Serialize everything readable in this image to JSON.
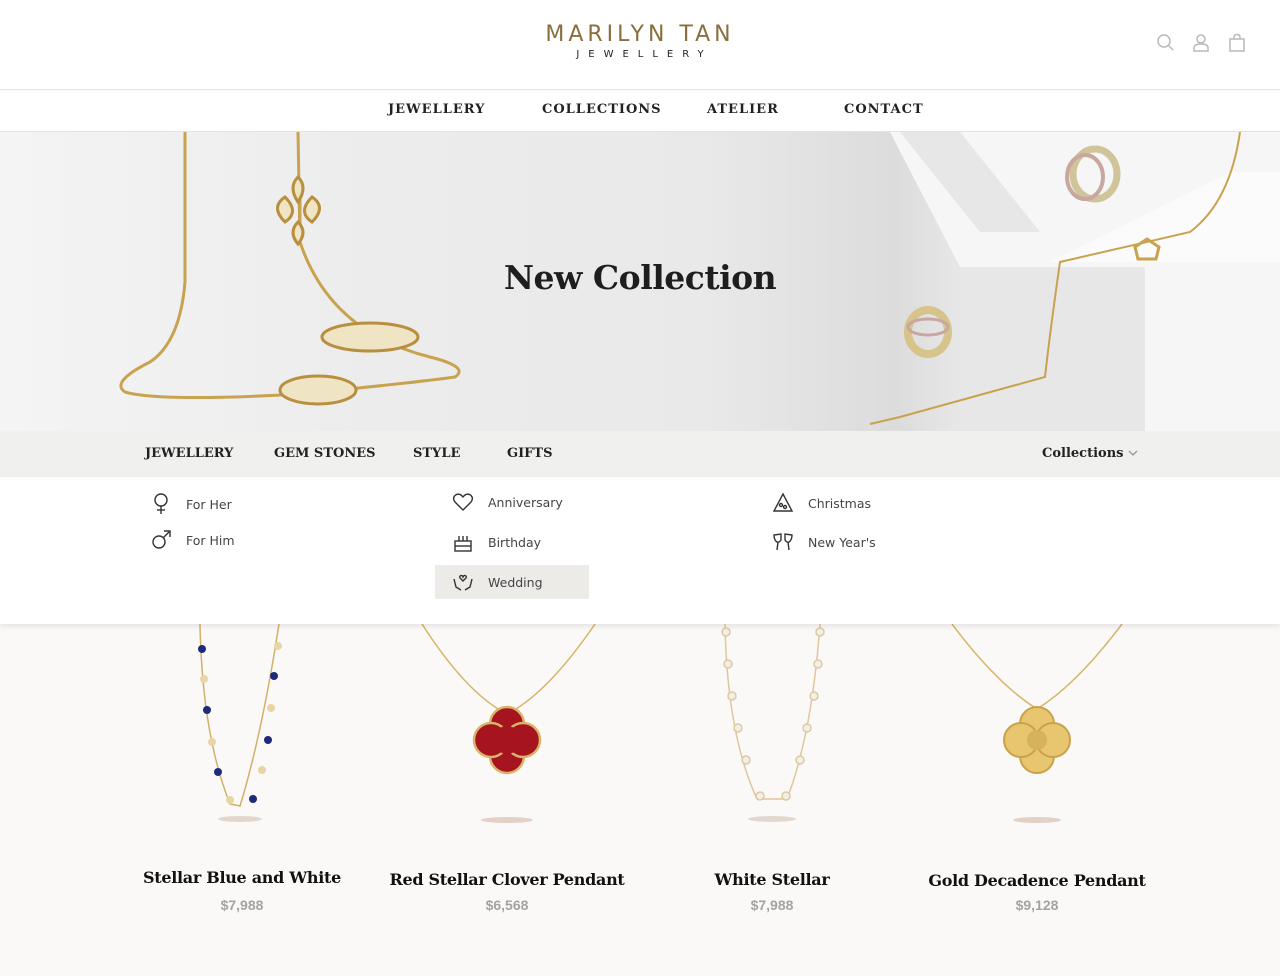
{
  "brand": {
    "name": "MARILYN TAN",
    "subtitle": "JEWELLERY"
  },
  "header": {
    "icons": [
      "search-icon",
      "user-icon",
      "bag-icon"
    ]
  },
  "main_nav": [
    "JEWELLERY",
    "COLLECTIONS",
    "ATELIER",
    "CONTACT"
  ],
  "hero": {
    "title": "New Collection"
  },
  "category_bar": {
    "items": [
      "JEWELLERY",
      "GEM STONES",
      "STYLE",
      "GIFTS"
    ],
    "collections_label": "Collections"
  },
  "dropdown": {
    "for_her": "For Her",
    "for_him": "For Him",
    "anniversary": "Anniversary",
    "birthday": "Birthday",
    "wedding": "Wedding",
    "christmas": "Christmas",
    "new_year": "New Year's"
  },
  "products": [
    {
      "name": "Stellar Blue and White",
      "price": "$7,988"
    },
    {
      "name": "Red Stellar Clover Pendant",
      "price": "$6,568"
    },
    {
      "name": "White Stellar",
      "price": "$7,988"
    },
    {
      "name": "Gold Decadence Pendant",
      "price": "$9,128"
    }
  ],
  "colors": {
    "brand_gold": "#8a6f3e",
    "price_gray": "#a3a3a3",
    "active_bg": "#ecebe8"
  }
}
